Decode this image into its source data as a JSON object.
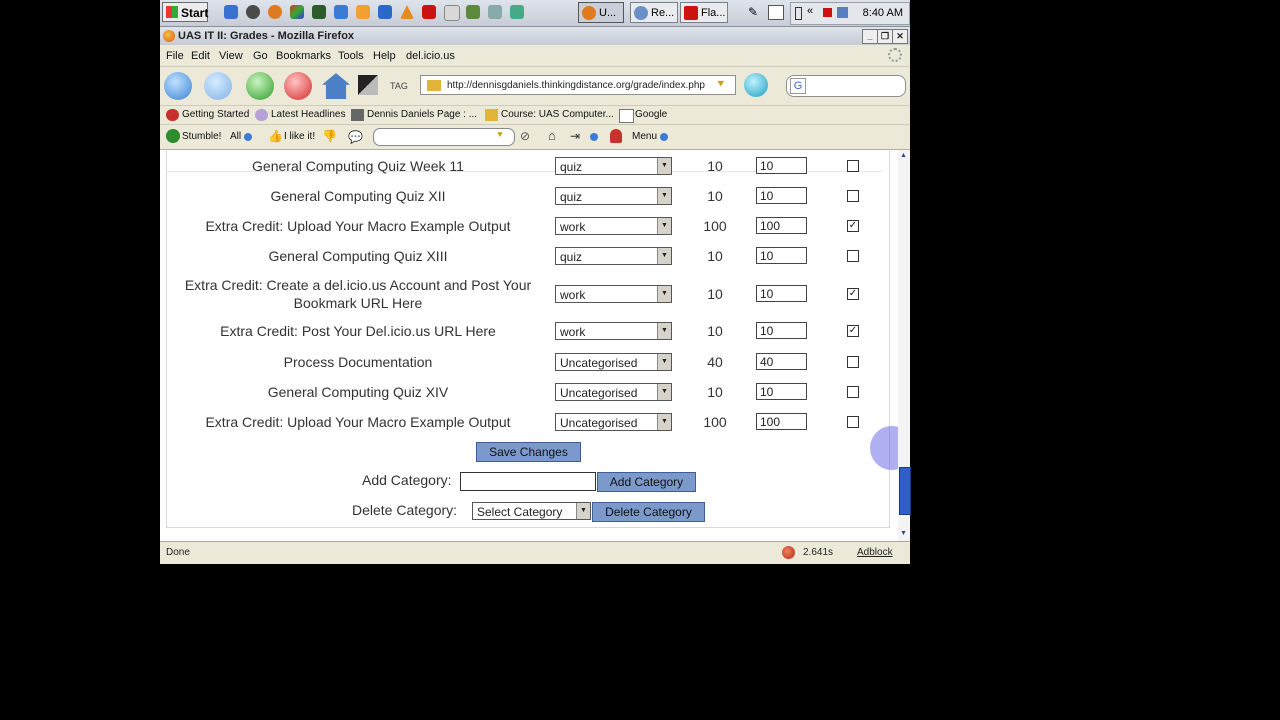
{
  "taskbar": {
    "start_label": "Start",
    "tasks": [
      "U...",
      "Re...",
      "Fla..."
    ],
    "tray_arrows": "«",
    "clock": "8:40 AM"
  },
  "window": {
    "title": "UAS IT II: Grades - Mozilla Firefox",
    "menu": [
      "File",
      "Edit",
      "View",
      "Go",
      "Bookmarks",
      "Tools",
      "Help",
      "del.icio.us"
    ],
    "url": "http://dennisgdaniels.thinkingdistance.org/grade/index.php",
    "search_engine_glyph": "G",
    "nav_tag_label": "TAG",
    "bookmarks": [
      "Getting Started",
      "Latest Headlines",
      "Dennis Daniels Page : ...",
      "Course: UAS Computer...",
      "Google"
    ],
    "stumble": {
      "stumble_label": "Stumble!",
      "all_label": "All",
      "like_label": "I like it!",
      "menu_label": "Menu"
    },
    "status": {
      "text": "Done",
      "time": "2.641s",
      "adblock": "Adblock"
    }
  },
  "grades": {
    "rows": [
      {
        "name": "General Computing Quiz Week 11",
        "category": "quiz",
        "points": "10",
        "value": "10",
        "checked": false
      },
      {
        "name": "General Computing Quiz XII",
        "category": "quiz",
        "points": "10",
        "value": "10",
        "checked": false
      },
      {
        "name": "Extra Credit: Upload Your Macro Example Output",
        "category": "work",
        "points": "100",
        "value": "100",
        "checked": true
      },
      {
        "name": "General Computing Quiz XIII",
        "category": "quiz",
        "points": "10",
        "value": "10",
        "checked": false
      },
      {
        "name": "Extra Credit: Create a del.icio.us Account and Post Your Bookmark URL Here",
        "category": "work",
        "points": "10",
        "value": "10",
        "checked": true
      },
      {
        "name": "Extra Credit: Post Your Del.icio.us URL Here",
        "category": "work",
        "points": "10",
        "value": "10",
        "checked": true
      },
      {
        "name": "Process Documentation",
        "category": "Uncategorised",
        "points": "40",
        "value": "40",
        "checked": false
      },
      {
        "name": "General Computing Quiz XIV",
        "category": "Uncategorised",
        "points": "10",
        "value": "10",
        "checked": false
      },
      {
        "name": "Extra Credit: Upload Your Macro Example Output",
        "category": "Uncategorised",
        "points": "100",
        "value": "100",
        "checked": false
      }
    ],
    "save_label": "Save Changes",
    "add_category_label": "Add Category:",
    "add_category_value": "",
    "add_category_button": "Add Category",
    "delete_category_label": "Delete Category:",
    "delete_category_select": "Select Category",
    "delete_category_button": "Delete Category"
  }
}
